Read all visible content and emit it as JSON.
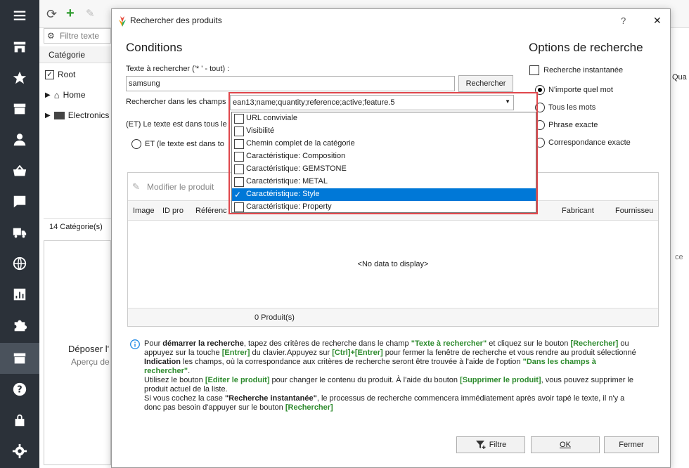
{
  "background": {
    "filter_placeholder": "Filtre texte",
    "category_header": "Catégorie",
    "tree": [
      {
        "label": "Root"
      },
      {
        "label": "Home"
      },
      {
        "label": "Electronics"
      }
    ],
    "category_count": "14 Catégorie(s)",
    "drop_text": "Déposer l'",
    "preview_text": "Aperçu de",
    "right_col_label": "Qua",
    "right_text": "ce"
  },
  "dialog": {
    "title": "Rechercher des produits",
    "help": "?",
    "close": "✕",
    "conditions_title": "Conditions",
    "options_title": "Options de recherche",
    "search_label": "Texte à rechercher ('* ' - tout) :",
    "search_value": "samsung",
    "search_button": "Rechercher",
    "fields_label": "Rechercher dans les champs",
    "fields_value": "ean13;name;quantity;reference;active;feature.5",
    "and_label": "(ET) Le texte est dans tous le",
    "and_radio_label": "ET (le texte est dans to",
    "instant_search": "Recherche instantanée",
    "options": [
      {
        "label": "N'importe quel mot",
        "selected": true
      },
      {
        "label": "Tous les mots",
        "selected": false
      },
      {
        "label": "Phrase exacte",
        "selected": false
      },
      {
        "label": "Correspondance exacte",
        "selected": false
      }
    ],
    "edit_product": "Modifier le produit",
    "columns": [
      "Image",
      "ID pro",
      "Référenc",
      "Fabricant",
      "Fournisseu"
    ],
    "no_data": "<No data to display>",
    "product_count": "0 Produit(s)",
    "info_lines": [
      {
        "parts": [
          [
            "",
            "Pour "
          ],
          [
            "b",
            "démarrer la recherche"
          ],
          [
            "",
            ", tapez des critères de recherche dans le champ "
          ],
          [
            "hl",
            "\"Texte à rechercher\""
          ],
          [
            "",
            " et cliquez sur le bouton "
          ],
          [
            "hl",
            "[Rechercher]"
          ],
          [
            "",
            " ou appuyez sur la touche "
          ],
          [
            "hl",
            "[Entrer]"
          ],
          [
            "",
            " du clavier.Appuyez sur "
          ],
          [
            "hl",
            "[Ctrl]+[Entrer]"
          ],
          [
            "",
            " pour fermer la fenêtre de recherche et vous rendre au produit sélectionné"
          ]
        ]
      },
      {
        "parts": [
          [
            "b",
            "Indication"
          ],
          [
            "",
            " les champs, où la correspondance aux critères de recherche seront être trouvée à l'aide de l'option "
          ],
          [
            "hl",
            " \"Dans les champs à rechercher\""
          ],
          [
            "",
            "."
          ]
        ]
      },
      {
        "parts": [
          [
            "",
            "Utilisez le bouton "
          ],
          [
            "hl",
            " [Editer le produit]"
          ],
          [
            "",
            " pour changer le contenu du produit. À l'aide du bouton "
          ],
          [
            "hl",
            " [Supprimer le produit]"
          ],
          [
            "",
            ", vous pouvez supprimer le produit actuel de la liste."
          ]
        ]
      },
      {
        "parts": [
          [
            "",
            "Si vous cochez la case "
          ],
          [
            "b",
            "\"Recherche instantanée\""
          ],
          [
            "",
            ", le processus de recherche commencera immédiatement après avoir tapé le texte, il n'y a donc pas besoin d'appuyer sur le bouton "
          ],
          [
            "hl",
            "[Rechercher]"
          ]
        ]
      }
    ],
    "filter_button": "Filtre",
    "ok_button": "OK",
    "close_button": "Fermer"
  },
  "dropdown": {
    "items": [
      {
        "label": "URL conviviale",
        "checked": false,
        "selected": false
      },
      {
        "label": "Visibilité",
        "checked": false,
        "selected": false
      },
      {
        "label": "Chemin complet de la catégorie",
        "checked": false,
        "selected": false
      },
      {
        "label": "Caractéristique: Composition",
        "checked": false,
        "selected": false
      },
      {
        "label": "Caractéristique: GEMSTONE",
        "checked": false,
        "selected": false
      },
      {
        "label": "Caractéristique: METAL",
        "checked": false,
        "selected": false
      },
      {
        "label": "Caractéristique: Style",
        "checked": true,
        "selected": true
      },
      {
        "label": "Caractéristique: Property",
        "checked": false,
        "selected": false
      }
    ]
  },
  "colors": {
    "sidebar": "#2b3139",
    "selection": "#0078d7",
    "highlight_frame": "#e0474c",
    "hint_green": "#2e8b2e"
  },
  "sidebar_icons": [
    "menu-icon",
    "store-icon",
    "star-icon",
    "inbox-icon",
    "user-icon",
    "basket-icon",
    "comment-icon",
    "truck-icon",
    "globe-icon",
    "chart-icon",
    "puzzle-icon",
    "archive-icon",
    "help-icon",
    "lock-icon",
    "gear-icon"
  ]
}
